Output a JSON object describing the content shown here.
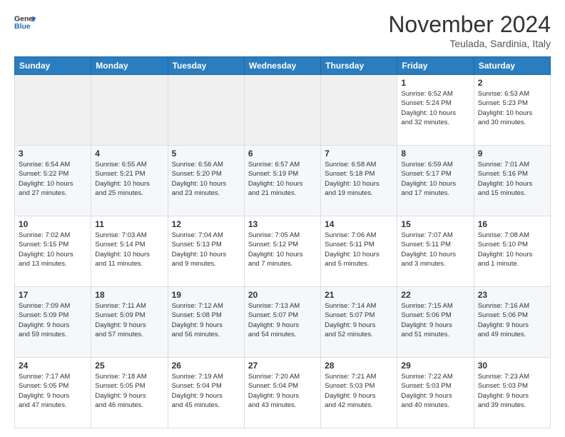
{
  "header": {
    "logo_general": "General",
    "logo_blue": "Blue",
    "month_title": "November 2024",
    "location": "Teulada, Sardinia, Italy"
  },
  "weekdays": [
    "Sunday",
    "Monday",
    "Tuesday",
    "Wednesday",
    "Thursday",
    "Friday",
    "Saturday"
  ],
  "weeks": [
    [
      {
        "day": "",
        "info": ""
      },
      {
        "day": "",
        "info": ""
      },
      {
        "day": "",
        "info": ""
      },
      {
        "day": "",
        "info": ""
      },
      {
        "day": "",
        "info": ""
      },
      {
        "day": "1",
        "info": "Sunrise: 6:52 AM\nSunset: 5:24 PM\nDaylight: 10 hours\nand 32 minutes."
      },
      {
        "day": "2",
        "info": "Sunrise: 6:53 AM\nSunset: 5:23 PM\nDaylight: 10 hours\nand 30 minutes."
      }
    ],
    [
      {
        "day": "3",
        "info": "Sunrise: 6:54 AM\nSunset: 5:22 PM\nDaylight: 10 hours\nand 27 minutes."
      },
      {
        "day": "4",
        "info": "Sunrise: 6:55 AM\nSunset: 5:21 PM\nDaylight: 10 hours\nand 25 minutes."
      },
      {
        "day": "5",
        "info": "Sunrise: 6:56 AM\nSunset: 5:20 PM\nDaylight: 10 hours\nand 23 minutes."
      },
      {
        "day": "6",
        "info": "Sunrise: 6:57 AM\nSunset: 5:19 PM\nDaylight: 10 hours\nand 21 minutes."
      },
      {
        "day": "7",
        "info": "Sunrise: 6:58 AM\nSunset: 5:18 PM\nDaylight: 10 hours\nand 19 minutes."
      },
      {
        "day": "8",
        "info": "Sunrise: 6:59 AM\nSunset: 5:17 PM\nDaylight: 10 hours\nand 17 minutes."
      },
      {
        "day": "9",
        "info": "Sunrise: 7:01 AM\nSunset: 5:16 PM\nDaylight: 10 hours\nand 15 minutes."
      }
    ],
    [
      {
        "day": "10",
        "info": "Sunrise: 7:02 AM\nSunset: 5:15 PM\nDaylight: 10 hours\nand 13 minutes."
      },
      {
        "day": "11",
        "info": "Sunrise: 7:03 AM\nSunset: 5:14 PM\nDaylight: 10 hours\nand 11 minutes."
      },
      {
        "day": "12",
        "info": "Sunrise: 7:04 AM\nSunset: 5:13 PM\nDaylight: 10 hours\nand 9 minutes."
      },
      {
        "day": "13",
        "info": "Sunrise: 7:05 AM\nSunset: 5:12 PM\nDaylight: 10 hours\nand 7 minutes."
      },
      {
        "day": "14",
        "info": "Sunrise: 7:06 AM\nSunset: 5:11 PM\nDaylight: 10 hours\nand 5 minutes."
      },
      {
        "day": "15",
        "info": "Sunrise: 7:07 AM\nSunset: 5:11 PM\nDaylight: 10 hours\nand 3 minutes."
      },
      {
        "day": "16",
        "info": "Sunrise: 7:08 AM\nSunset: 5:10 PM\nDaylight: 10 hours\nand 1 minute."
      }
    ],
    [
      {
        "day": "17",
        "info": "Sunrise: 7:09 AM\nSunset: 5:09 PM\nDaylight: 9 hours\nand 59 minutes."
      },
      {
        "day": "18",
        "info": "Sunrise: 7:11 AM\nSunset: 5:09 PM\nDaylight: 9 hours\nand 57 minutes."
      },
      {
        "day": "19",
        "info": "Sunrise: 7:12 AM\nSunset: 5:08 PM\nDaylight: 9 hours\nand 56 minutes."
      },
      {
        "day": "20",
        "info": "Sunrise: 7:13 AM\nSunset: 5:07 PM\nDaylight: 9 hours\nand 54 minutes."
      },
      {
        "day": "21",
        "info": "Sunrise: 7:14 AM\nSunset: 5:07 PM\nDaylight: 9 hours\nand 52 minutes."
      },
      {
        "day": "22",
        "info": "Sunrise: 7:15 AM\nSunset: 5:06 PM\nDaylight: 9 hours\nand 51 minutes."
      },
      {
        "day": "23",
        "info": "Sunrise: 7:16 AM\nSunset: 5:06 PM\nDaylight: 9 hours\nand 49 minutes."
      }
    ],
    [
      {
        "day": "24",
        "info": "Sunrise: 7:17 AM\nSunset: 5:05 PM\nDaylight: 9 hours\nand 47 minutes."
      },
      {
        "day": "25",
        "info": "Sunrise: 7:18 AM\nSunset: 5:05 PM\nDaylight: 9 hours\nand 46 minutes."
      },
      {
        "day": "26",
        "info": "Sunrise: 7:19 AM\nSunset: 5:04 PM\nDaylight: 9 hours\nand 45 minutes."
      },
      {
        "day": "27",
        "info": "Sunrise: 7:20 AM\nSunset: 5:04 PM\nDaylight: 9 hours\nand 43 minutes."
      },
      {
        "day": "28",
        "info": "Sunrise: 7:21 AM\nSunset: 5:03 PM\nDaylight: 9 hours\nand 42 minutes."
      },
      {
        "day": "29",
        "info": "Sunrise: 7:22 AM\nSunset: 5:03 PM\nDaylight: 9 hours\nand 40 minutes."
      },
      {
        "day": "30",
        "info": "Sunrise: 7:23 AM\nSunset: 5:03 PM\nDaylight: 9 hours\nand 39 minutes."
      }
    ]
  ]
}
